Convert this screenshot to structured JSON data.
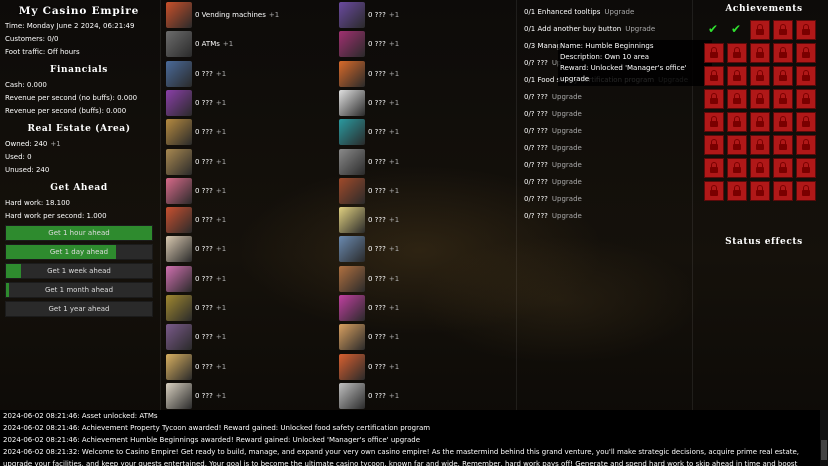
{
  "header": {
    "title": "My Casino Empire",
    "time": "Time: Monday June 2 2024, 06:21:49",
    "customers": "Customers: 0/0",
    "foot_traffic": "Foot traffic: Off hours"
  },
  "financials": {
    "heading": "Financials",
    "cash": "Cash: 0.000",
    "rps_no_buff": "Revenue per second (no buffs): 0.000",
    "rps_buff": "Revenue per second (buffs): 0.000"
  },
  "real_estate": {
    "heading": "Real Estate (Area)",
    "owned": "Owned: 240",
    "owned_plus": "+1",
    "used": "Used: 0",
    "unused": "Unused: 240"
  },
  "get_ahead": {
    "heading": "Get Ahead",
    "hard_work": "Hard work: 18.100",
    "hard_work_ps": "Hard work per second: 1.000",
    "buttons": [
      {
        "label": "Get 1 hour ahead",
        "progress": 1.0
      },
      {
        "label": "Get 1 day ahead",
        "progress": 0.75
      },
      {
        "label": "Get 1 week ahead",
        "progress": 0.1
      },
      {
        "label": "Get 1 month ahead",
        "progress": 0.02
      },
      {
        "label": "Get 1 year ahead",
        "progress": 0.0
      }
    ]
  },
  "items_col1": [
    {
      "label": "0 Vending machines",
      "plus": "+1",
      "icon": "vending-machine-icon",
      "color": "#c9502a"
    },
    {
      "label": "0 ATMs",
      "plus": "+1",
      "icon": "atm-icon",
      "color": "#6c6c6c"
    },
    {
      "label": "0 ???",
      "plus": "+1",
      "icon": "arcade-machine-icon",
      "color": "#4a6a9a"
    },
    {
      "label": "0 ???",
      "plus": "+1",
      "icon": "slot-machine-icon",
      "color": "#8a3fa8"
    },
    {
      "label": "0 ???",
      "plus": "+1",
      "icon": "card-table-icon",
      "color": "#b58a40"
    },
    {
      "label": "0 ???",
      "plus": "+1",
      "icon": "blackjack-table-icon",
      "color": "#a88850"
    },
    {
      "label": "0 ???",
      "plus": "+1",
      "icon": "dice-icon",
      "color": "#d86a8a"
    },
    {
      "label": "0 ???",
      "plus": "+1",
      "icon": "roulette-icon",
      "color": "#c85030"
    },
    {
      "label": "0 ???",
      "plus": "+1",
      "icon": "coffee-cup-icon",
      "color": "#d8c8b0"
    },
    {
      "label": "0 ???",
      "plus": "+1",
      "icon": "chips-icon",
      "color": "#d070b0"
    },
    {
      "label": "0 ???",
      "plus": "+1",
      "icon": "poker-table-icon",
      "color": "#a08830"
    },
    {
      "label": "0 ???",
      "plus": "+1",
      "icon": "chair-icon",
      "color": "#7a5a8a"
    },
    {
      "label": "0 ???",
      "plus": "+1",
      "icon": "bag-icon",
      "color": "#d8b060"
    },
    {
      "label": "0 ???",
      "plus": "+1",
      "icon": "ticket-icon",
      "color": "#d8d0c0"
    }
  ],
  "items_col2": [
    {
      "label": "0 ???",
      "plus": "+1",
      "icon": "slot-cabinet-icon",
      "color": "#6a4aa0"
    },
    {
      "label": "0 ???",
      "plus": "+1",
      "icon": "slot-machine-icon",
      "color": "#a03070"
    },
    {
      "label": "0 ???",
      "plus": "+1",
      "icon": "shopping-bag-icon",
      "color": "#d86a2a"
    },
    {
      "label": "0 ???",
      "plus": "+1",
      "icon": "playing-cards-icon",
      "color": "#e0e0e0"
    },
    {
      "label": "0 ???",
      "plus": "+1",
      "icon": "cash-register-icon",
      "color": "#2a9aa0"
    },
    {
      "label": "0 ???",
      "plus": "+1",
      "icon": "safe-icon",
      "color": "#8a8a8a"
    },
    {
      "label": "0 ???",
      "plus": "+1",
      "icon": "cowboy-hat-icon",
      "color": "#a04a2a"
    },
    {
      "label": "0 ???",
      "plus": "+1",
      "icon": "champagne-icon",
      "color": "#e0d080"
    },
    {
      "label": "0 ???",
      "plus": "+1",
      "icon": "bed-icon",
      "color": "#6a8ab0"
    },
    {
      "label": "0 ???",
      "plus": "+1",
      "icon": "portrait-icon",
      "color": "#b07040"
    },
    {
      "label": "0 ???",
      "plus": "+1",
      "icon": "arcade-icon",
      "color": "#c040a0"
    },
    {
      "label": "0 ???",
      "plus": "+1",
      "icon": "food-plate-icon",
      "color": "#d8a060"
    },
    {
      "label": "0 ???",
      "plus": "+1",
      "icon": "buffet-icon",
      "color": "#d86030"
    },
    {
      "label": "0 ???",
      "plus": "+1",
      "icon": "token-icon",
      "color": "#c0c0c0"
    }
  ],
  "upgrades": [
    {
      "label": "0/1 Enhanced tooltips",
      "action": "Upgrade"
    },
    {
      "label": "0/1 Add another buy button",
      "action": "Upgrade"
    },
    {
      "label": "0/3 Manag",
      "action": ""
    },
    {
      "label": "0/? ???",
      "action": "Up"
    },
    {
      "label": "0/1 Food safety certification program",
      "action": "Upgrade"
    },
    {
      "label": "0/? ???",
      "action": "Upgrade"
    },
    {
      "label": "0/? ???",
      "action": "Upgrade"
    },
    {
      "label": "0/? ???",
      "action": "Upgrade"
    },
    {
      "label": "0/? ???",
      "action": "Upgrade"
    },
    {
      "label": "0/? ???",
      "action": "Upgrade"
    },
    {
      "label": "0/? ???",
      "action": "Upgrade"
    },
    {
      "label": "0/? ???",
      "action": "Upgrade"
    },
    {
      "label": "0/? ???",
      "action": "Upgrade"
    }
  ],
  "tooltip": {
    "name": "Name: Humble Beginnings",
    "description": "Description: Own 10 area",
    "reward": "Reward: Unlocked 'Manager's office' upgrade"
  },
  "achievements": {
    "heading": "Achievements",
    "unlocked_count": 2,
    "total": 40
  },
  "status_effects": {
    "heading": "Status effects"
  },
  "log": [
    "2024-06-02 08:21:46: Asset unlocked: ATMs",
    "2024-06-02 08:21:46: Achievement Property Tycoon awarded! Reward gained: Unlocked food safety certification program",
    "2024-06-02 08:21:46: Achievement Humble Beginnings awarded! Reward gained: Unlocked 'Manager's office' upgrade",
    "2024-06-02 08:21:32: Welcome to Casino Empire! Get ready to build, manage, and expand your very own casino empire! As the mastermind behind this grand venture, you'll make strategic decisions, acquire prime real estate, upgrade your facilities, and keep your guests entertained. Your goal is to become the ultimate casino tycoon, known far and wide. Remember, hard work pays off! Generate and spend hard work to skip ahead in time and boost your revenue. Dive in, take"
  ]
}
